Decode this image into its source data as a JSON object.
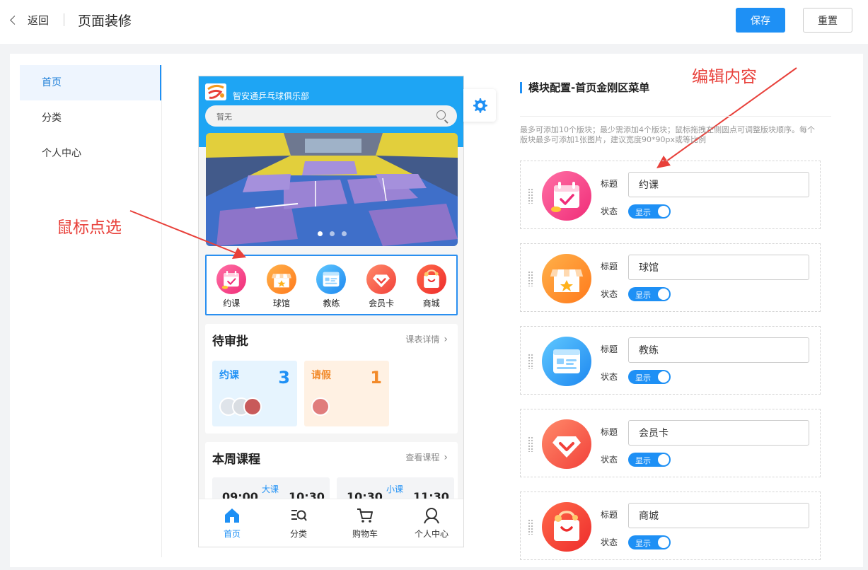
{
  "header": {
    "back_label": "返回",
    "title": "页面装修",
    "save_label": "保存",
    "reset_label": "重置"
  },
  "sidebar": {
    "items": [
      {
        "label": "首页"
      },
      {
        "label": "分类"
      },
      {
        "label": "个人中心"
      }
    ]
  },
  "preview": {
    "club_name": "智安通乒乓球俱乐部",
    "search_placeholder": "暂无",
    "menu": [
      {
        "label": "约课"
      },
      {
        "label": "球馆"
      },
      {
        "label": "教练"
      },
      {
        "label": "会员卡"
      },
      {
        "label": "商城"
      }
    ],
    "pending": {
      "title": "待审批",
      "link": "课表详情",
      "tiles": [
        {
          "name": "约课",
          "count": "3"
        },
        {
          "name": "请假",
          "count": "1"
        }
      ]
    },
    "week": {
      "title": "本周课程",
      "link": "查看课程",
      "courses": [
        {
          "start": "09:00",
          "tag": "大课",
          "end": "10:30"
        },
        {
          "start": "10:30",
          "tag": "小课",
          "end": "11:30"
        }
      ]
    },
    "tabbar": [
      {
        "label": "首页"
      },
      {
        "label": "分类"
      },
      {
        "label": "购物车"
      },
      {
        "label": "个人中心"
      }
    ]
  },
  "annotations": {
    "select": "鼠标点选",
    "edit": "编辑内容"
  },
  "config": {
    "title": "模块配置-首页金刚区菜单",
    "hint": "最多可添加10个版块；最少需添加4个版块；鼠标拖拽左侧圆点可调整版块顺序。每个版块最多可添加1张图片，建议宽度90*90px或等比例",
    "field_title": "标题",
    "field_state": "状态",
    "blocks": [
      {
        "title": "约课",
        "state": "显示"
      },
      {
        "title": "球馆",
        "state": "显示"
      },
      {
        "title": "教练",
        "state": "显示"
      },
      {
        "title": "会员卡",
        "state": "显示"
      },
      {
        "title": "商城",
        "state": "显示"
      }
    ]
  },
  "colors": {
    "primary": "#1e90f5",
    "header": "#1ea5f4",
    "annotation": "#e8403a"
  }
}
